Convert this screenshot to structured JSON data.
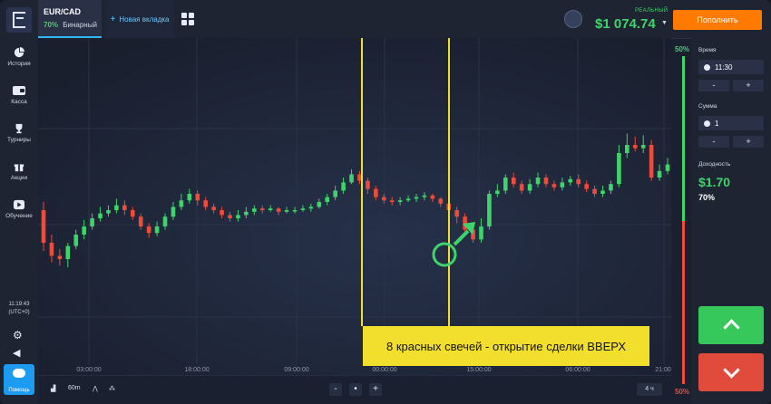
{
  "header": {
    "asset_name": "EUR/CAD",
    "asset_payout": "70%",
    "asset_type": "Бинарный",
    "new_tab_label": "Новая вкладка",
    "account_label": "РЕАЛЬНЫЙ",
    "balance": "$1 074.74",
    "deposit_label": "Пополнить"
  },
  "sidebar": {
    "items": [
      {
        "label": "История",
        "icon": "pie-chart-icon"
      },
      {
        "label": "Касса",
        "icon": "wallet-icon"
      },
      {
        "label": "Турниры",
        "icon": "trophy-icon"
      },
      {
        "label": "Акции",
        "icon": "gift-icon"
      },
      {
        "label": "Обучение",
        "icon": "play-icon"
      }
    ],
    "time": "11:19:43",
    "timezone": "(UTC+0)",
    "help_label": "Помощь"
  },
  "chart_data": {
    "type": "candlestick",
    "x_tick_labels": [
      "03:00:00",
      "18:00:00",
      "09:00:00",
      "00:00:00",
      "15:00:00",
      "06:00:00",
      "21:00:"
    ],
    "candles_note_colors": {
      "up": "#3fd46b",
      "down": "#ef4b3a"
    },
    "candles": [
      [
        0.5,
        0.3,
        0.55,
        0.25
      ],
      [
        0.3,
        0.22,
        0.35,
        0.18
      ],
      [
        0.22,
        0.2,
        0.26,
        0.16
      ],
      [
        0.2,
        0.28,
        0.3,
        0.15
      ],
      [
        0.28,
        0.35,
        0.38,
        0.26
      ],
      [
        0.35,
        0.4,
        0.44,
        0.32
      ],
      [
        0.4,
        0.45,
        0.48,
        0.38
      ],
      [
        0.45,
        0.48,
        0.52,
        0.43
      ],
      [
        0.48,
        0.5,
        0.53,
        0.46
      ],
      [
        0.5,
        0.53,
        0.57,
        0.48
      ],
      [
        0.53,
        0.5,
        0.56,
        0.47
      ],
      [
        0.5,
        0.46,
        0.52,
        0.44
      ],
      [
        0.46,
        0.4,
        0.48,
        0.38
      ],
      [
        0.4,
        0.36,
        0.42,
        0.33
      ],
      [
        0.36,
        0.4,
        0.43,
        0.34
      ],
      [
        0.4,
        0.46,
        0.48,
        0.38
      ],
      [
        0.46,
        0.52,
        0.55,
        0.44
      ],
      [
        0.52,
        0.56,
        0.6,
        0.5
      ],
      [
        0.56,
        0.6,
        0.63,
        0.54
      ],
      [
        0.6,
        0.56,
        0.62,
        0.53
      ],
      [
        0.56,
        0.52,
        0.58,
        0.5
      ],
      [
        0.52,
        0.5,
        0.54,
        0.48
      ],
      [
        0.5,
        0.47,
        0.52,
        0.45
      ],
      [
        0.47,
        0.45,
        0.49,
        0.43
      ],
      [
        0.45,
        0.47,
        0.5,
        0.43
      ],
      [
        0.47,
        0.49,
        0.52,
        0.45
      ],
      [
        0.49,
        0.51,
        0.53,
        0.47
      ],
      [
        0.51,
        0.5,
        0.53,
        0.48
      ],
      [
        0.5,
        0.51,
        0.53,
        0.49
      ],
      [
        0.51,
        0.49,
        0.52,
        0.47
      ],
      [
        0.49,
        0.5,
        0.52,
        0.48
      ],
      [
        0.5,
        0.5,
        0.52,
        0.48
      ],
      [
        0.5,
        0.51,
        0.53,
        0.49
      ],
      [
        0.51,
        0.52,
        0.54,
        0.49
      ],
      [
        0.52,
        0.55,
        0.57,
        0.51
      ],
      [
        0.55,
        0.58,
        0.6,
        0.53
      ],
      [
        0.58,
        0.62,
        0.65,
        0.56
      ],
      [
        0.62,
        0.67,
        0.7,
        0.6
      ],
      [
        0.67,
        0.72,
        0.75,
        0.66
      ],
      [
        0.72,
        0.68,
        0.74,
        0.66
      ],
      [
        0.68,
        0.63,
        0.7,
        0.6
      ],
      [
        0.63,
        0.58,
        0.65,
        0.56
      ],
      [
        0.58,
        0.56,
        0.6,
        0.54
      ],
      [
        0.56,
        0.55,
        0.58,
        0.53
      ],
      [
        0.55,
        0.56,
        0.58,
        0.53
      ],
      [
        0.56,
        0.57,
        0.59,
        0.55
      ],
      [
        0.57,
        0.58,
        0.6,
        0.55
      ],
      [
        0.58,
        0.59,
        0.61,
        0.56
      ],
      [
        0.59,
        0.57,
        0.6,
        0.55
      ],
      [
        0.57,
        0.54,
        0.58,
        0.52
      ],
      [
        0.54,
        0.5,
        0.55,
        0.48
      ],
      [
        0.5,
        0.46,
        0.52,
        0.42
      ],
      [
        0.46,
        0.38,
        0.48,
        0.36
      ],
      [
        0.38,
        0.32,
        0.4,
        0.3
      ],
      [
        0.32,
        0.4,
        0.45,
        0.3
      ],
      [
        0.4,
        0.6,
        0.62,
        0.38
      ],
      [
        0.6,
        0.62,
        0.66,
        0.58
      ],
      [
        0.62,
        0.7,
        0.72,
        0.6
      ],
      [
        0.7,
        0.66,
        0.73,
        0.64
      ],
      [
        0.66,
        0.62,
        0.68,
        0.6
      ],
      [
        0.62,
        0.66,
        0.69,
        0.6
      ],
      [
        0.66,
        0.7,
        0.73,
        0.64
      ],
      [
        0.7,
        0.66,
        0.72,
        0.64
      ],
      [
        0.66,
        0.64,
        0.68,
        0.62
      ],
      [
        0.64,
        0.67,
        0.7,
        0.62
      ],
      [
        0.67,
        0.69,
        0.71,
        0.65
      ],
      [
        0.69,
        0.66,
        0.72,
        0.64
      ],
      [
        0.66,
        0.63,
        0.68,
        0.61
      ],
      [
        0.63,
        0.6,
        0.65,
        0.58
      ],
      [
        0.6,
        0.62,
        0.65,
        0.58
      ],
      [
        0.62,
        0.66,
        0.68,
        0.6
      ],
      [
        0.66,
        0.85,
        0.9,
        0.64
      ],
      [
        0.85,
        0.9,
        0.97,
        0.82
      ],
      [
        0.9,
        0.88,
        0.95,
        0.86
      ],
      [
        0.88,
        0.9,
        0.96,
        0.85
      ],
      [
        0.9,
        0.7,
        0.93,
        0.68
      ],
      [
        0.7,
        0.74,
        0.78,
        0.68
      ],
      [
        0.74,
        0.78,
        0.82,
        0.72
      ]
    ]
  },
  "vertical_markers": [
    "open-line",
    "close-line"
  ],
  "bottombar": {
    "timeframe": "60m",
    "zoom_minus": "-",
    "zoom_dot": "•",
    "zoom_plus": "+",
    "period": "4 ч"
  },
  "indicator": {
    "top_pct": "50%",
    "bottom_pct": "50%"
  },
  "panel": {
    "time_label": "Время",
    "time_value": "11:30",
    "amount_label": "Сумма",
    "amount_value": "1",
    "minus": "-",
    "plus": "+",
    "payout_label": "Доходность",
    "payout_value": "$1.70",
    "payout_pct": "70%"
  },
  "annotation": {
    "text": "8 красных свечей - открытие сделки ВВЕРХ"
  }
}
